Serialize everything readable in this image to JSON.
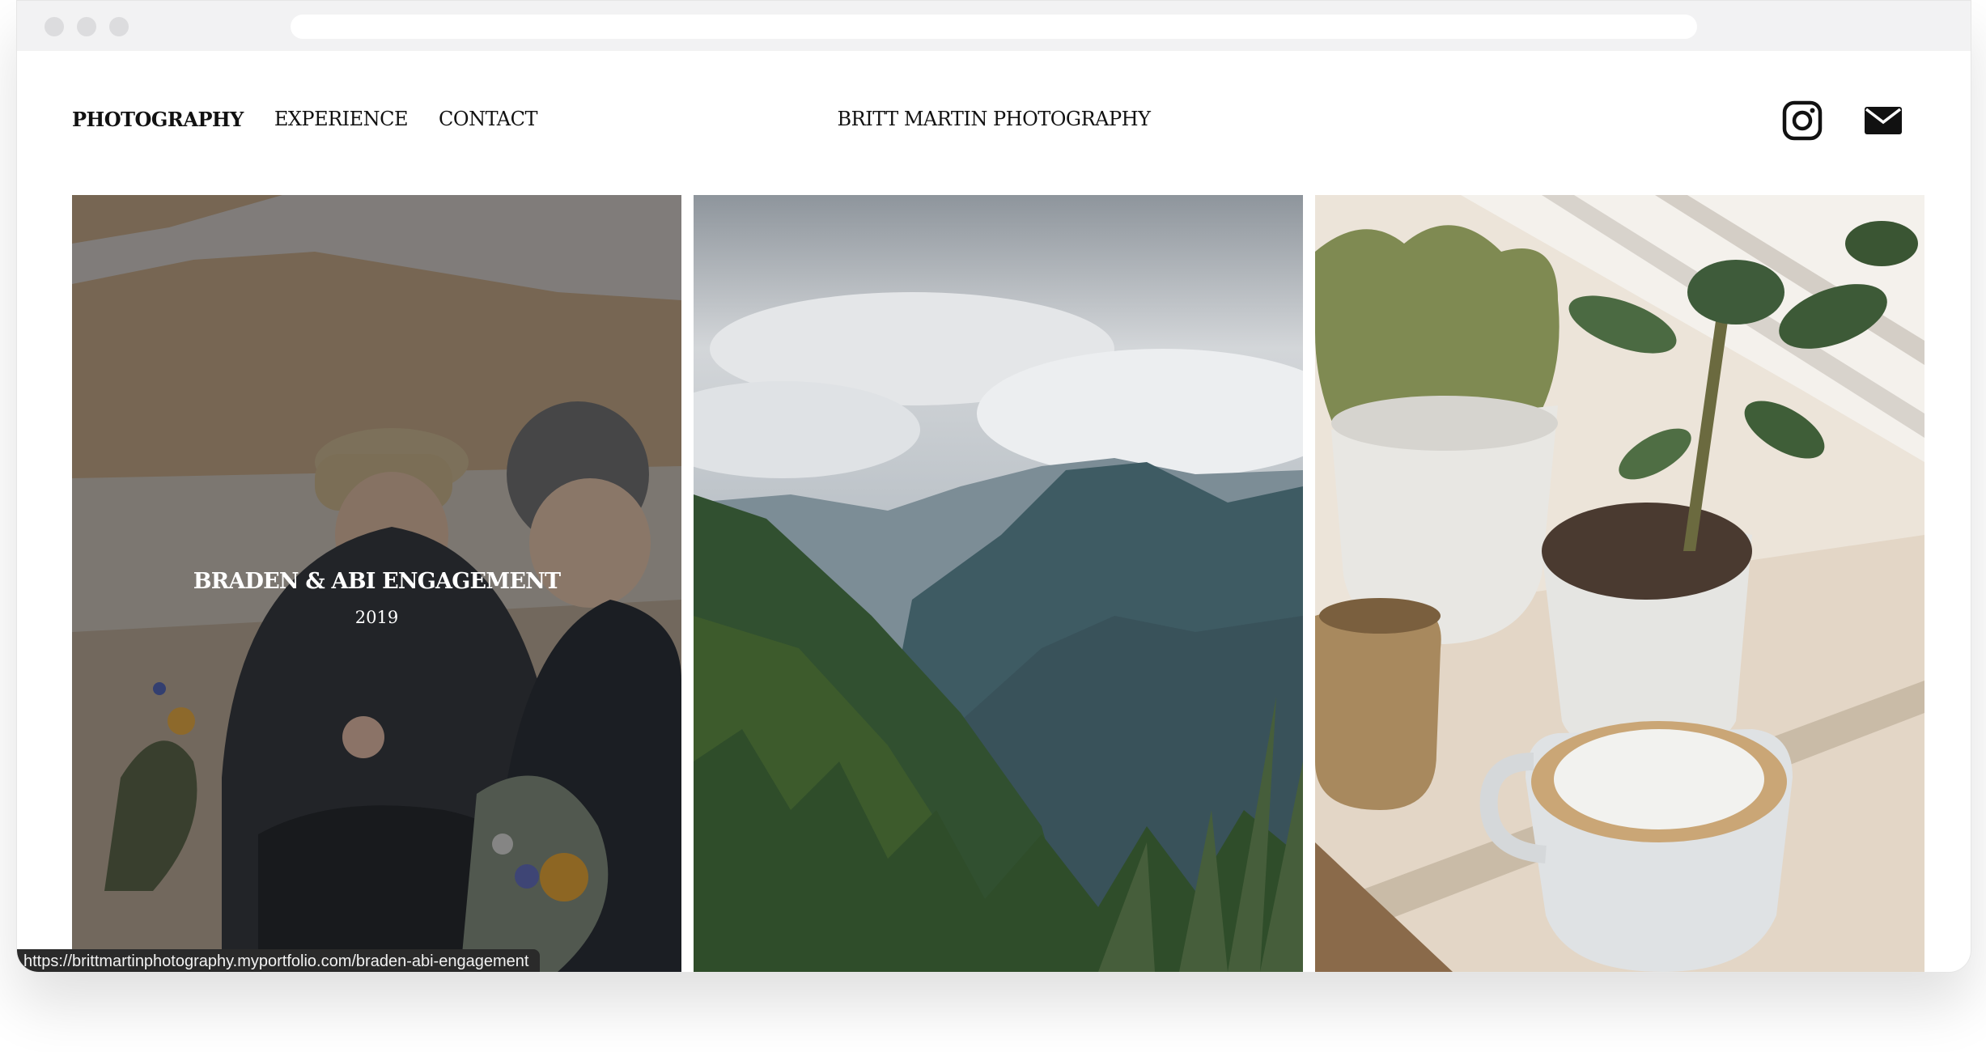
{
  "nav": {
    "items": [
      {
        "label": "PHOTOGRAPHY",
        "active": true
      },
      {
        "label": "EXPERIENCE",
        "active": false
      },
      {
        "label": "CONTACT",
        "active": false
      }
    ]
  },
  "site_title": "BRITT MARTIN PHOTOGRAPHY",
  "header_icons": [
    "instagram-icon",
    "mail-icon"
  ],
  "gallery": {
    "tiles": [
      {
        "title": "BRADEN & ABI ENGAGEMENT",
        "year": "2019",
        "hovered": true
      },
      {
        "title": "",
        "year": "",
        "hovered": false
      },
      {
        "title": "",
        "year": "",
        "hovered": false
      }
    ]
  },
  "status_bar": {
    "url": "https://brittmartinphotography.myportfolio.com/braden-abi-engagement"
  },
  "colors": {
    "text": "#111111",
    "overlay": "#141419",
    "chrome": "#f2f2f3"
  }
}
